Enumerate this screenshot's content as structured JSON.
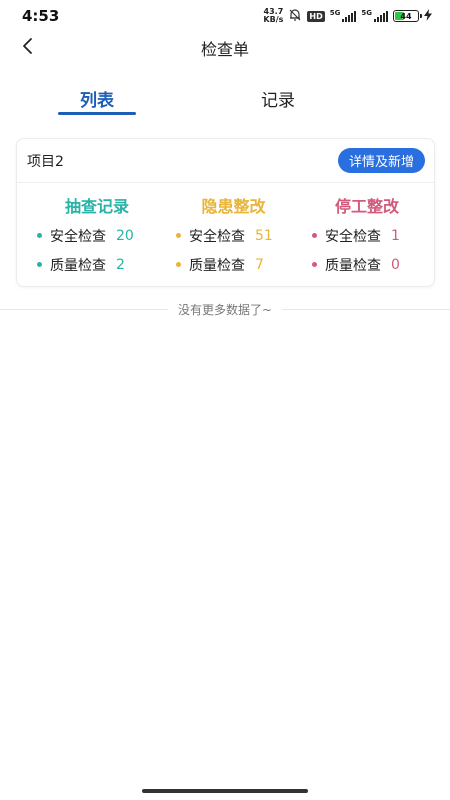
{
  "status_bar": {
    "time": "4:53",
    "net_speed_value": "43.7",
    "net_speed_unit": "KB/s",
    "hd_label": "HD",
    "signal1_label": "5G",
    "signal2_label": "5G",
    "battery_level": "44",
    "icons": [
      "bell-muted-icon",
      "signal-icon",
      "battery-icon",
      "charging-icon"
    ]
  },
  "nav": {
    "title": "检查单",
    "back_icon": "chevron-left-icon"
  },
  "tabs": [
    {
      "label": "列表",
      "active": true
    },
    {
      "label": "记录",
      "active": false
    }
  ],
  "card": {
    "project_name": "项目2",
    "detail_button": "详情及新增",
    "columns": [
      {
        "title": "抽查记录",
        "color": "#27b3a6",
        "rows": [
          {
            "label": "安全检查",
            "value": "20"
          },
          {
            "label": "质量检查",
            "value": "2"
          }
        ]
      },
      {
        "title": "隐患整改",
        "color": "#e8b43a",
        "rows": [
          {
            "label": "安全检查",
            "value": "51"
          },
          {
            "label": "质量检查",
            "value": "7"
          }
        ]
      },
      {
        "title": "停工整改",
        "color": "#d35a7a",
        "rows": [
          {
            "label": "安全检查",
            "value": "1"
          },
          {
            "label": "质量检查",
            "value": "0"
          }
        ]
      }
    ]
  },
  "footer": {
    "no_more_text": "没有更多数据了~"
  },
  "colors": {
    "accent": "#1e5eb8",
    "button": "#2a6fe0"
  }
}
